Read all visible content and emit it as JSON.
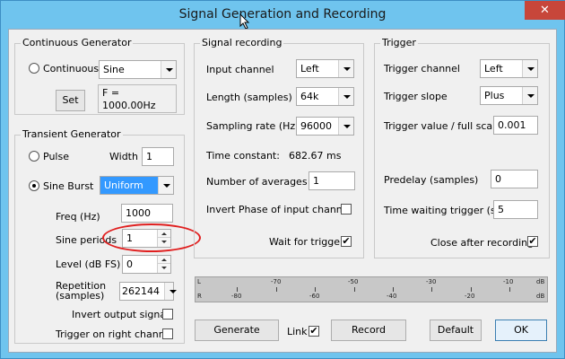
{
  "window": {
    "title": "Signal Generation and Recording",
    "close_glyph": "✕"
  },
  "continuous": {
    "title": "Continuous Generator",
    "radio_label": "Continuous",
    "waveform": "Sine",
    "set_label": "Set",
    "freq_readout": "F = 1000.00Hz"
  },
  "transient": {
    "title": "Transient Generator",
    "pulse_label": "Pulse",
    "width_label": "Width",
    "width_value": "1",
    "sine_burst_label": "Sine Burst",
    "burst_type": "Uniform",
    "freq_label": "Freq (Hz)",
    "freq_value": "1000",
    "sine_periods_label": "Sine periods",
    "sine_periods_value": "1",
    "level_label": "Level (dB FS)",
    "level_value": "0",
    "repetition_label_1": "Repetition",
    "repetition_label_2": "(samples)",
    "repetition_value": "262144",
    "invert_output_label": "Invert output signal",
    "trigger_right_label": "Trigger on right channel"
  },
  "recording": {
    "title": "Signal recording",
    "input_channel_label": "Input channel",
    "input_channel_value": "Left",
    "length_label": "Length (samples)",
    "length_value": "64k",
    "sampling_rate_label": "Sampling rate (Hz)",
    "sampling_rate_value": "96000",
    "time_constant_label": "Time constant:",
    "time_constant_value": "682.67 ms",
    "averages_label": "Number of averages",
    "averages_value": "1",
    "invert_phase_label": "Invert Phase of input channel",
    "wait_trigger_label": "Wait for trigger",
    "check_mark": "✔"
  },
  "trigger": {
    "title": "Trigger",
    "channel_label": "Trigger channel",
    "channel_value": "Left",
    "slope_label": "Trigger slope",
    "slope_value": "Plus",
    "value_label": "Trigger value / full scale",
    "value_value": "0.001",
    "predelay_label": "Predelay (samples)",
    "predelay_value": "0",
    "waiting_label": "Time waiting trigger (s)",
    "waiting_value": "5",
    "close_after_label": "Close after recording"
  },
  "meter": {
    "left_label": "L",
    "right_label": "R",
    "top_ticks": [
      "-70",
      "-50",
      "-30",
      "-10",
      "dB"
    ],
    "bottom_ticks": [
      "-80",
      "-60",
      "-40",
      "-20",
      "dB"
    ]
  },
  "buttons": {
    "generate": "Generate",
    "link_label": "Link",
    "record": "Record",
    "default": "Default",
    "ok": "OK"
  }
}
